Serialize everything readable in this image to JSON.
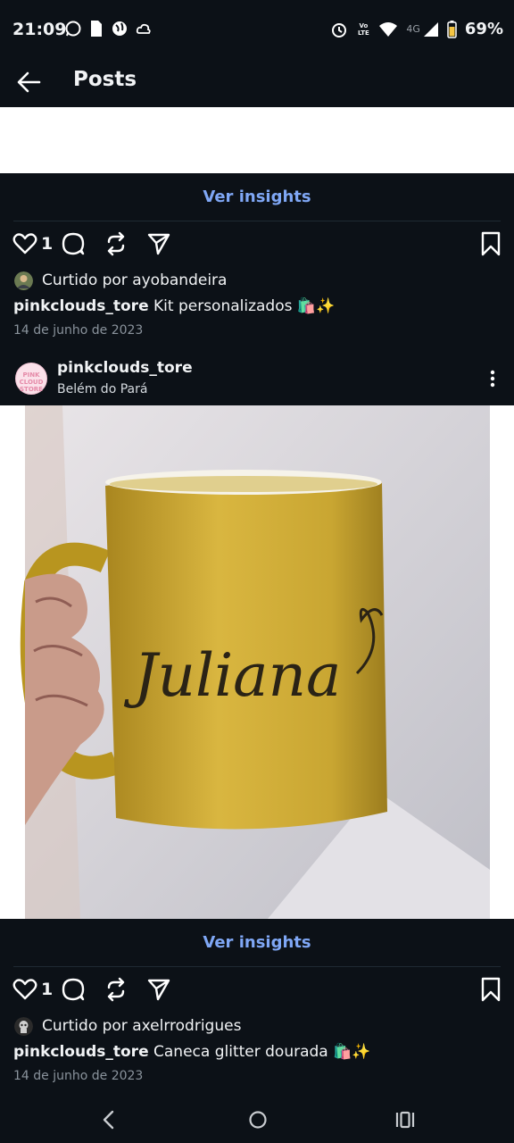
{
  "status_bar": {
    "time": "21:09",
    "battery": "69%",
    "network": "4G",
    "volte": "Vo LTE"
  },
  "header": {
    "title": "Posts"
  },
  "posts": [
    {
      "insights_label": "Ver insights",
      "likes": "1",
      "liked_by": "Curtido por ayobandeira",
      "caption_user": "pinkclouds_tore",
      "caption_text": " Kit personalizados 🛍️✨",
      "date": "14 de junho de 2023"
    },
    {
      "username": "pinkclouds_tore",
      "location": "Belém do Pará",
      "avatar_text": "PINK CLOUD STORE",
      "image": {
        "description": "Gold glitter mug with name",
        "mug_text": "Juliana",
        "mug_color": "#c9a632"
      },
      "insights_label": "Ver insights",
      "likes": "1",
      "liked_by": "Curtido por axelrrodrigues",
      "caption_user": "pinkclouds_tore",
      "caption_text": " Caneca glitter dourada 🛍️✨",
      "date": "14 de junho de 2023"
    }
  ],
  "colors": {
    "background": "#0c1117",
    "link": "#7fa7f5",
    "date": "#8a939c"
  }
}
